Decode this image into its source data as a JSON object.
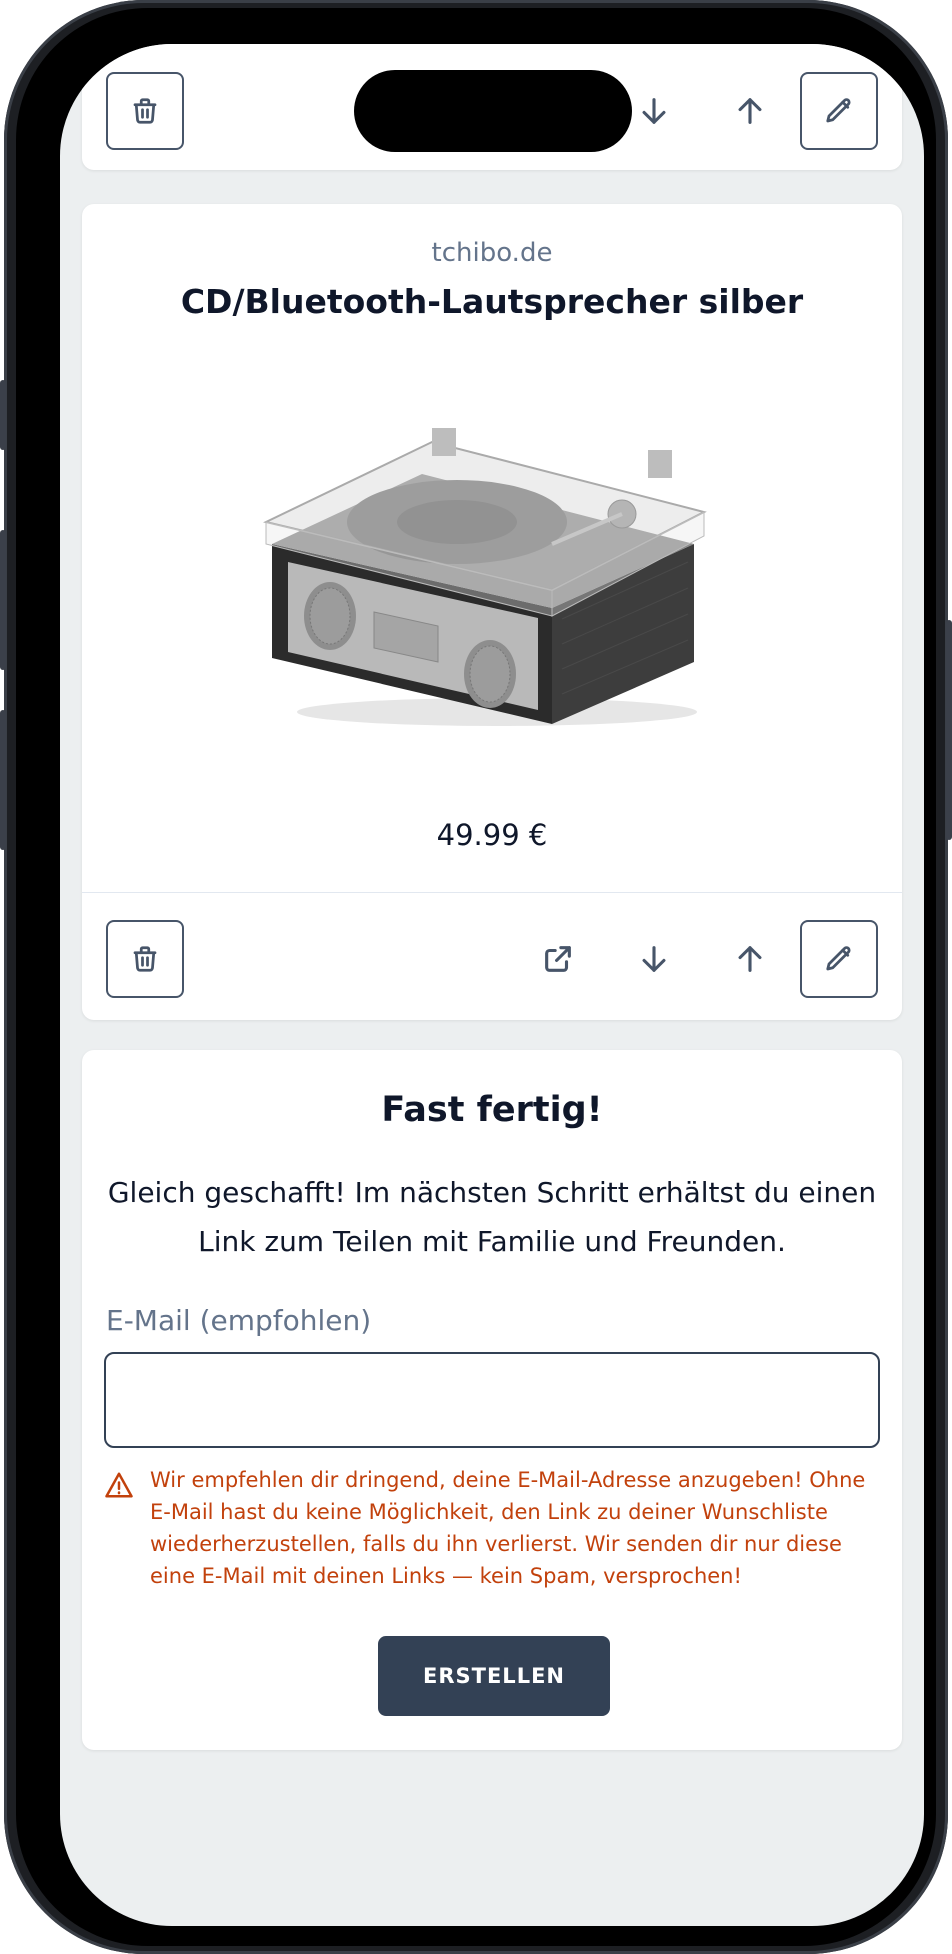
{
  "cards": [
    {
      "actions": [
        "delete",
        "move-down",
        "move-up",
        "edit"
      ]
    },
    {
      "domain": "tchibo.de",
      "title": "CD/Bluetooth-Lautsprecher silber",
      "price": "49.99 €",
      "actions": [
        "delete",
        "open-link",
        "move-down",
        "move-up",
        "edit"
      ]
    }
  ],
  "finish": {
    "title": "Fast fertig!",
    "text": "Gleich geschafft! Im nächsten Schritt erhältst du einen Link zum Teilen mit Familie und Freunden.",
    "email_label": "E-Mail (empfohlen)",
    "email_value": "",
    "email_placeholder": "",
    "warning": "Wir empfehlen dir dringend, deine E-Mail-Adresse anzugeben! Ohne E-Mail hast du keine Möglichkeit, den Link zu deiner Wunschliste wiederherzustellen, falls du ihn verlierst. Wir senden dir nur diese eine E-Mail mit deinen Links — kein Spam, versprochen!",
    "button_label": "ERSTELLEN"
  },
  "icons": [
    "trash-icon",
    "arrow-down-icon",
    "arrow-up-icon",
    "pencil-icon",
    "external-link-icon",
    "warning-icon"
  ],
  "colors": {
    "primary": "#334155",
    "warning": "#c2410c",
    "muted": "#64748b",
    "background": "#eceff0"
  }
}
